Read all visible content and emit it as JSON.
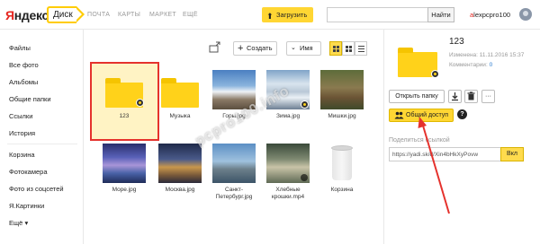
{
  "header": {
    "logo_ya": "Я",
    "logo_rest": "ндекс",
    "disk_label": "Диск",
    "nav": [
      "ПОЧТА",
      "КАРТЫ",
      "МАРКЕТ",
      "ЕЩЁ"
    ],
    "upload_label": "Загрузить",
    "search_placeholder": "",
    "search_button": "Найти",
    "username_first": "a",
    "username_rest": "lexpcpro100"
  },
  "sidebar": {
    "items": [
      "Файлы",
      "Все фото",
      "Альбомы",
      "Общие папки",
      "Ссылки",
      "История",
      "Корзина",
      "Фотокамера",
      "Фото из соцсетей",
      "Я.Картинки",
      "Ещё"
    ],
    "more_suffix": "▾"
  },
  "toolbar": {
    "create_label": "Создать",
    "sort_label": "Имя"
  },
  "files": [
    {
      "name": "123",
      "kind": "folder-shared",
      "selected": true
    },
    {
      "name": "Музыка",
      "kind": "folder"
    },
    {
      "name": "Горы.jpg",
      "kind": "photo-mountain"
    },
    {
      "name": "Зима.jpg",
      "kind": "photo-winter"
    },
    {
      "name": "Мишки.jpg",
      "kind": "photo-bears"
    },
    {
      "name": "Море.jpg",
      "kind": "photo-sea"
    },
    {
      "name": "Москва.jpg",
      "kind": "photo-moscow"
    },
    {
      "name": "Санкт-Петербург.jpg",
      "kind": "photo-spb"
    },
    {
      "name": "Хлебные крошки.mp4",
      "kind": "video"
    },
    {
      "name": "Корзина",
      "kind": "trash"
    }
  ],
  "file_labels": {
    "f0": "123",
    "f1": "Музыка",
    "f2": "Горы.jpg",
    "f3": "Зима.jpg",
    "f4": "Мишки.jpg",
    "f5": "Море.jpg",
    "f6": "Москва.jpg",
    "f7a": "Санкт-",
    "f7b": "Петербург.jpg",
    "f8a": "Хлебные",
    "f8b": "крошки.mp4",
    "f9": "Корзина"
  },
  "watermark": "pcpro100.info",
  "panel": {
    "title": "123",
    "modified_label": "Изменена:",
    "modified_value": "11.11.2016 15:37",
    "comments_label": "Комментарии:",
    "comments_value": "0",
    "open_folder": "Открыть папку",
    "more_dots": "···",
    "share_label": "Общий доступ",
    "help": "?",
    "share_link_label": "Поделиться ссылкой",
    "share_link_value": "https://yadi.sk/d/Xin4bHkXyPovw",
    "toggle_label": "Вкл"
  },
  "colors": {
    "accent_yellow": "#ffd633",
    "folder_yellow": "#ffd21a",
    "selection_red": "#e5322d",
    "link_blue": "#2a7bd0",
    "logo_red": "#e52620"
  },
  "icons": [
    "search-icon",
    "upload-arrow-icon",
    "plus-icon",
    "chevron-down-icon",
    "grid-view-icon",
    "list-view-icon",
    "folder-icon",
    "share-badge-icon",
    "trash-icon",
    "download-icon",
    "delete-icon",
    "more-icon",
    "users-icon",
    "help-icon",
    "arrow-annotation"
  ]
}
